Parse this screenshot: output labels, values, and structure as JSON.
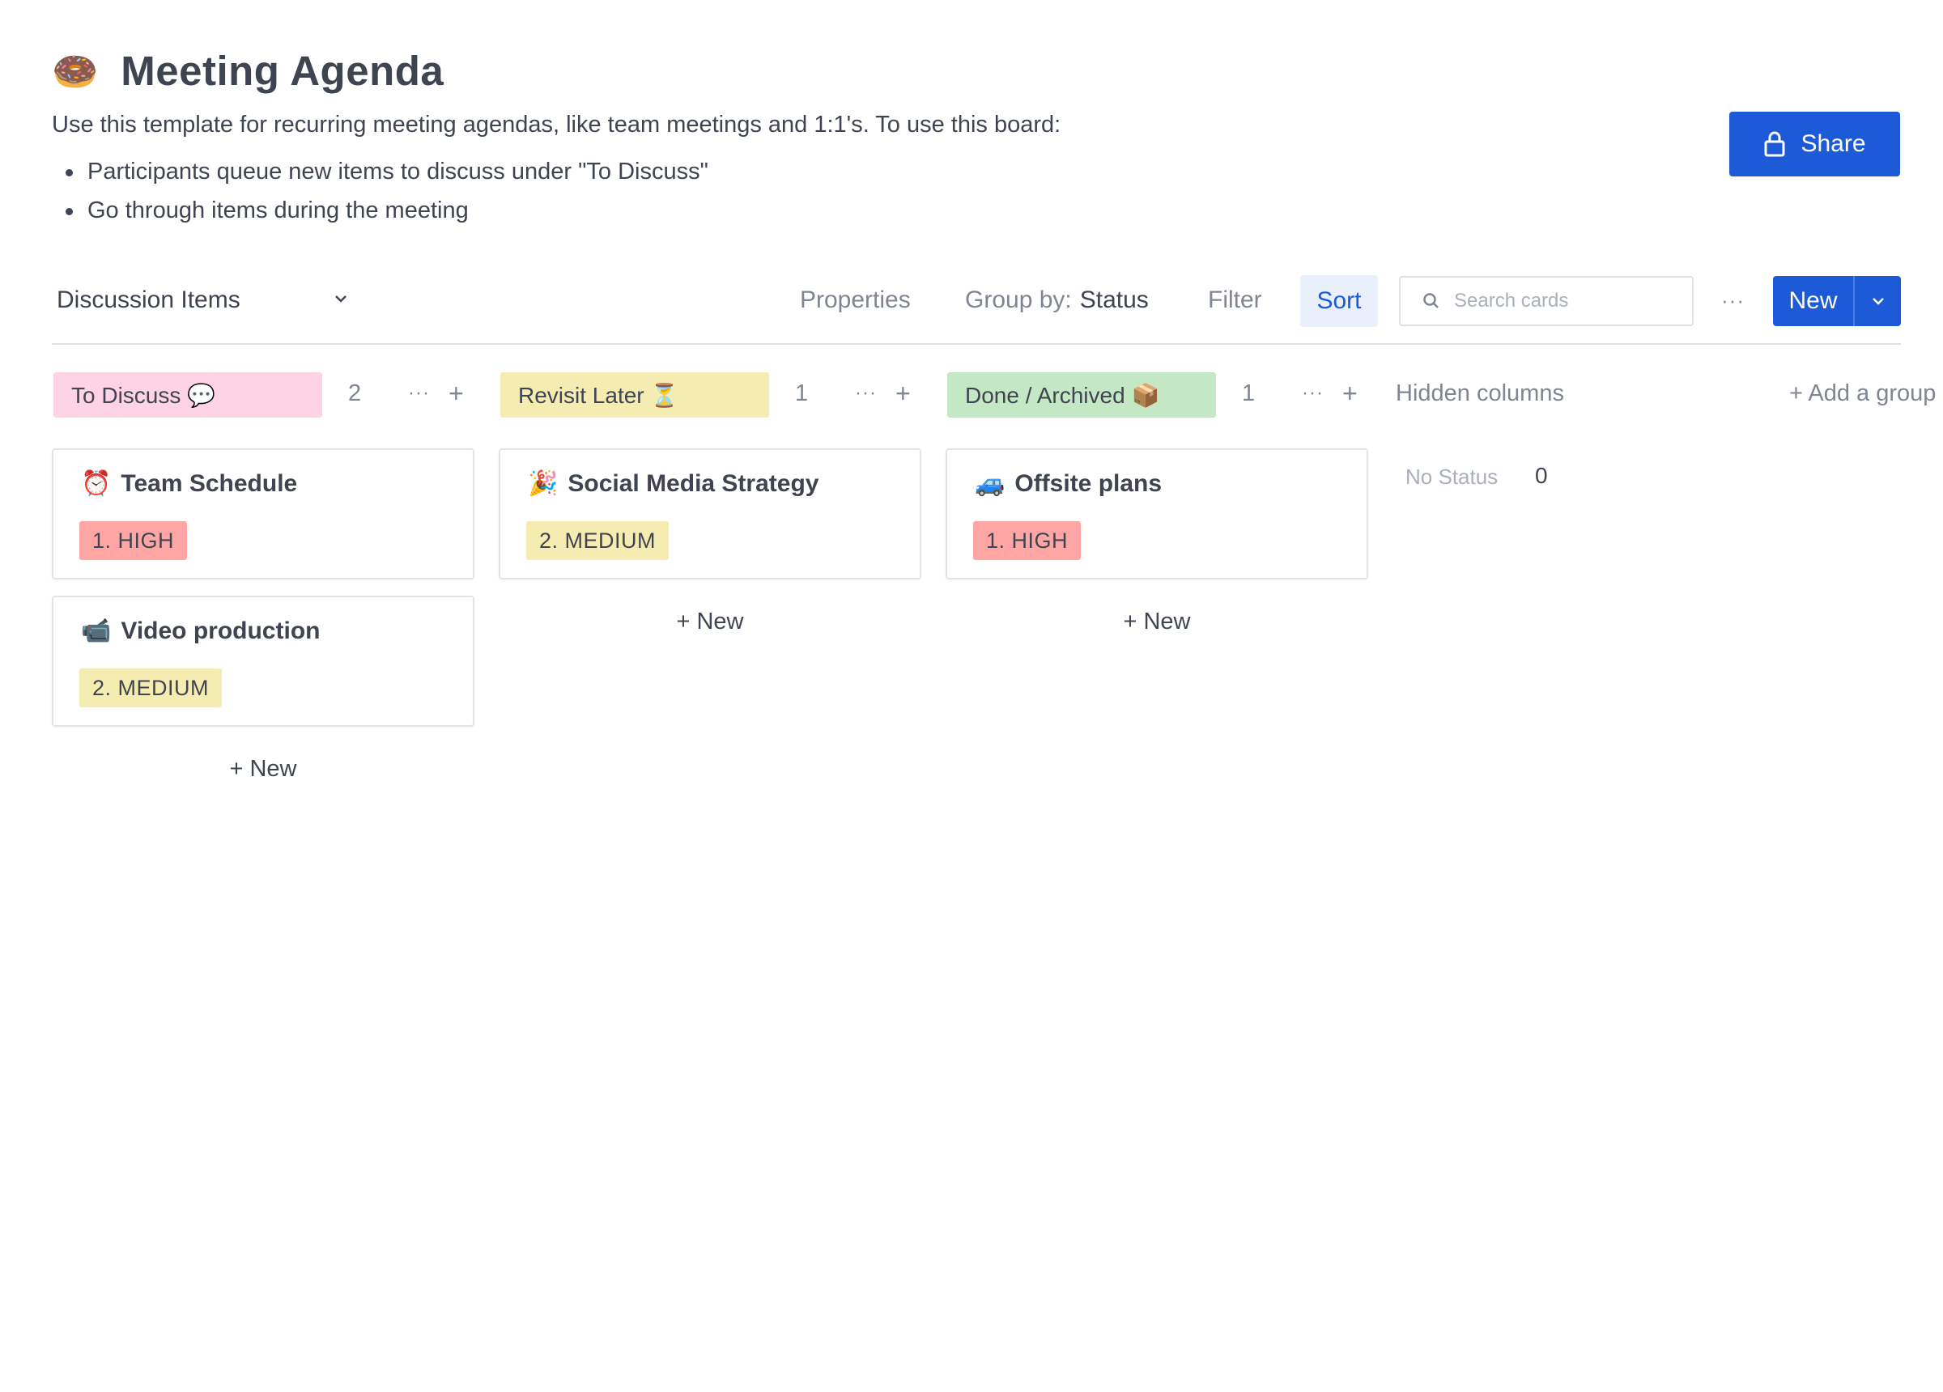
{
  "header": {
    "icon": "🍩",
    "title": "Meeting Agenda",
    "description": "Use this template for recurring meeting agendas, like team meetings and 1:1's. To use this board:",
    "bullets": [
      "Participants queue new items to discuss under \"To Discuss\"",
      "Go through items during the meeting"
    ],
    "share_label": "Share"
  },
  "toolbar": {
    "view_name": "Discussion Items",
    "properties_label": "Properties",
    "group_by_label": "Group by:",
    "group_by_value": "Status",
    "filter_label": "Filter",
    "sort_label": "Sort",
    "search_placeholder": "Search cards",
    "more_label": "···",
    "new_label": "New"
  },
  "columns": [
    {
      "name": "To Discuss 💬",
      "count": "2",
      "color": "#fdd3e5",
      "more_label": "···",
      "add_label": "+",
      "cards": [
        {
          "emoji": "⏰",
          "title": "Team Schedule",
          "tag": "1. HIGH"
        },
        {
          "emoji": "📹",
          "title": "Video production",
          "tag": "2. MEDIUM"
        }
      ],
      "new_label": "+ New"
    },
    {
      "name": "Revisit Later ⏳",
      "count": "1",
      "color": "#f5ecb2",
      "more_label": "···",
      "add_label": "+",
      "cards": [
        {
          "emoji": "🎉",
          "title": "Social Media Strategy",
          "tag": "2. MEDIUM"
        }
      ],
      "new_label": "+ New"
    },
    {
      "name": "Done / Archived 📦",
      "count": "1",
      "color": "#c5e8c4",
      "more_label": "···",
      "add_label": "+",
      "cards": [
        {
          "emoji": "🚙",
          "title": "Offsite plans",
          "tag": "1. HIGH"
        }
      ],
      "new_label": "+ New"
    }
  ],
  "hidden_columns": {
    "label": "Hidden columns",
    "items": [
      {
        "name": "No Status",
        "count": "0"
      }
    ]
  },
  "add_group_label": "+ Add a group",
  "colors": {
    "accent": "#1d5ad7",
    "tag_high": "#ffa6a4",
    "tag_medium": "#f5ecb2"
  }
}
